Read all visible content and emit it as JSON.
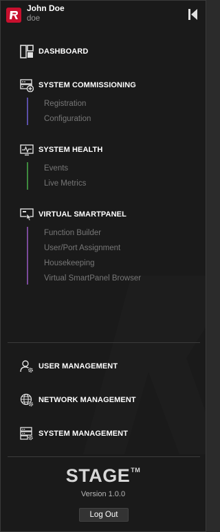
{
  "user": {
    "name": "John Doe",
    "username": "doe"
  },
  "colors": {
    "brand_red": "#c8102e",
    "commissioning_line": "#5b4fa8",
    "health_line": "#3e8a3e",
    "smartpanel_line": "#7a4a9a"
  },
  "nav": {
    "dashboard": {
      "label": "DASHBOARD",
      "icon": "dashboard-icon"
    },
    "commissioning": {
      "label": "SYSTEM COMMISSIONING",
      "icon": "system-commissioning-icon",
      "items": [
        "Registration",
        "Configuration"
      ]
    },
    "health": {
      "label": "SYSTEM HEALTH",
      "icon": "system-health-icon",
      "items": [
        "Events",
        "Live Metrics"
      ]
    },
    "smartpanel": {
      "label": "VIRTUAL SMARTPANEL",
      "icon": "virtual-smartpanel-icon",
      "items": [
        "Function Builder",
        "User/Port Assignment",
        "Housekeeping",
        "Virtual SmartPanel Browser"
      ]
    }
  },
  "management": {
    "user": {
      "label": "USER MANAGEMENT",
      "icon": "user-management-icon"
    },
    "network": {
      "label": "NETWORK MANAGEMENT",
      "icon": "network-management-icon"
    },
    "system": {
      "label": "SYSTEM MANAGEMENT",
      "icon": "system-management-icon"
    }
  },
  "footer": {
    "brand": "STAGE",
    "trademark": "TM",
    "version": "Version 1.0.0",
    "logout_label": "Log Out"
  }
}
